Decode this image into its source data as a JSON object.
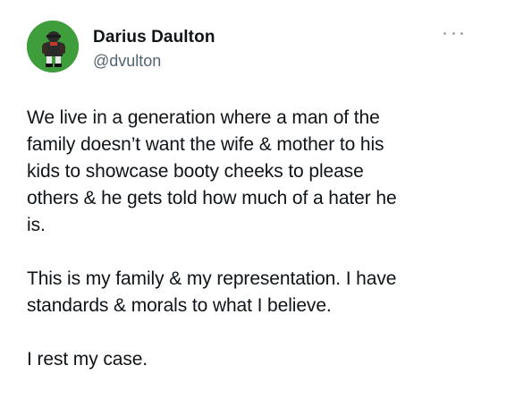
{
  "tweet": {
    "author": {
      "display_name": "Darius Daulton",
      "handle": "@dvulton",
      "avatar_icon": "profile-avatar",
      "avatar_color": "#3f9e3c"
    },
    "more_icon": "more-options-icon",
    "paragraphs": [
      "We live in a generation where a man of the\nfamily doesn’t want the wife & mother to his\nkids to showcase booty cheeks to please\nothers & he gets told how much of a hater he\nis.",
      "This is my family & my representation. I have\nstandards & morals to what I believe.",
      "I rest my case."
    ]
  }
}
